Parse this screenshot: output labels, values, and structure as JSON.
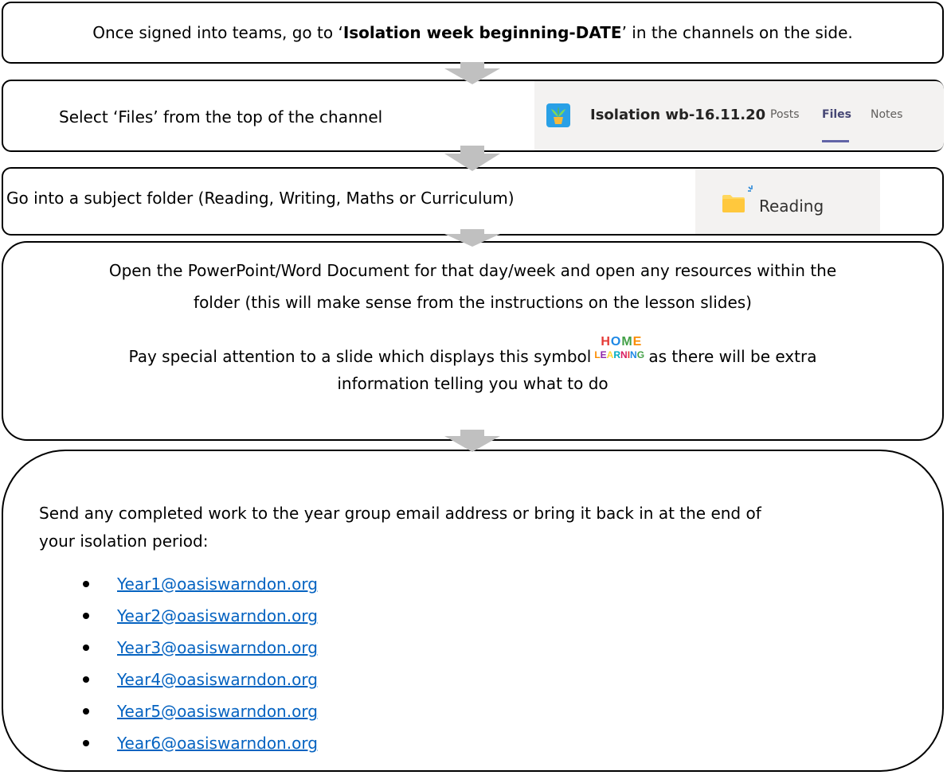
{
  "step1": {
    "pre": "Once signed into teams, go to ‘",
    "bold": "Isolation week beginning-DATE",
    "post": "’ in the channels on the side."
  },
  "step2": {
    "text": "Select ‘Files’ from the top of the channel",
    "teams_channel": "Isolation wb-16.11.20",
    "tabs": [
      "Posts",
      "Files",
      "Notes"
    ],
    "active_tab": "Files"
  },
  "step3": {
    "text": "Go into a subject folder (Reading, Writing, Maths or Curriculum)",
    "folder_name": "Reading"
  },
  "step4": {
    "line1": "Open the PowerPoint/Word Document for that day/week and open any resources within the",
    "line2": "folder (this will make sense from the instructions on the lesson slides)",
    "line3_pre": "Pay special attention to a slide which displays this symbol",
    "line3_post": "as there will be extra",
    "line4": "information telling you what to do",
    "symbol_top": "HOME",
    "symbol_bottom": "LEARNING"
  },
  "step5": {
    "line1": "Send any completed work to the year group email address or bring it back in at the end of",
    "line2": "your isolation period:",
    "emails": [
      "Year1@oasiswarndon.org",
      "Year2@oasiswarndon.org",
      "Year3@oasiswarndon.org",
      "Year4@oasiswarndon.org",
      "Year5@oasiswarndon.org",
      "Year6@oasiswarndon.org"
    ]
  },
  "colors": {
    "arrow": "#c0c0c0",
    "link": "#0563c1",
    "teams_tile": "#29a0e6",
    "tab_underline": "#6264a7",
    "folder": "#ffd75e"
  }
}
